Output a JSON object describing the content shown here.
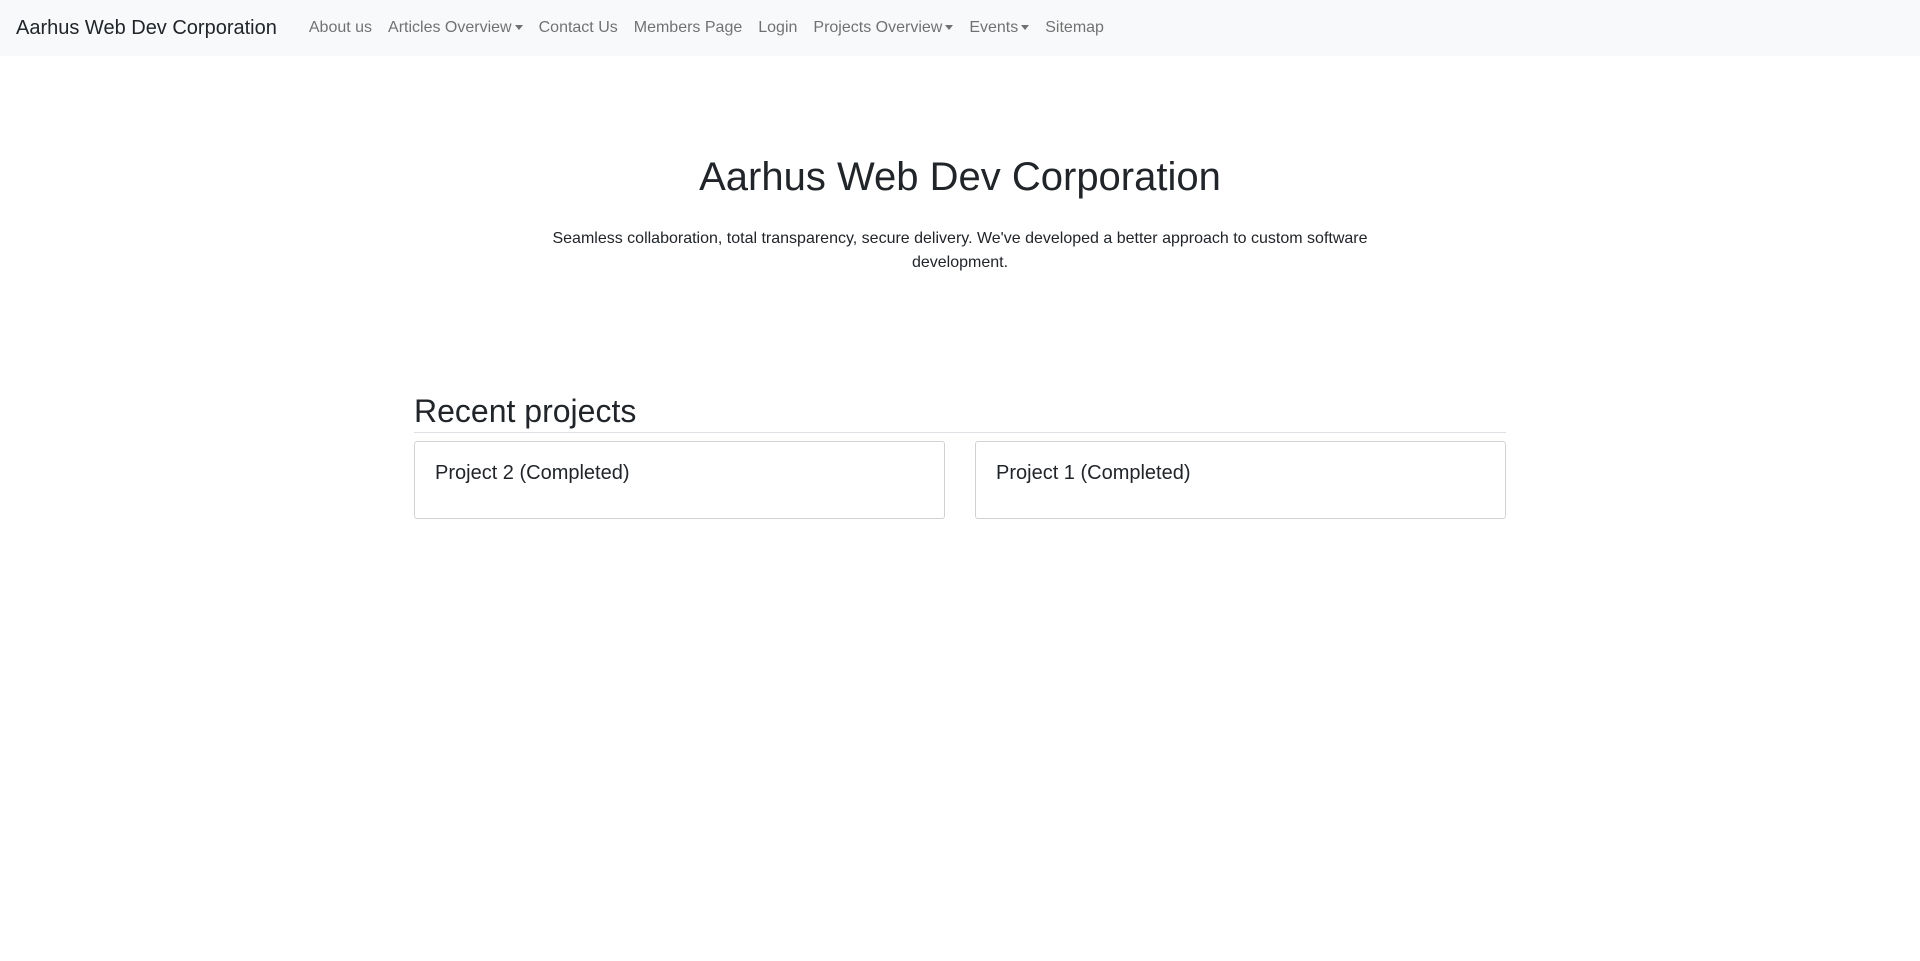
{
  "navbar": {
    "brand": "Aarhus Web Dev Corporation",
    "items": [
      {
        "label": "About us",
        "dropdown": false
      },
      {
        "label": "Articles Overview",
        "dropdown": true
      },
      {
        "label": "Contact Us",
        "dropdown": false
      },
      {
        "label": "Members Page",
        "dropdown": false
      },
      {
        "label": "Login",
        "dropdown": false
      },
      {
        "label": "Projects Overview",
        "dropdown": true
      },
      {
        "label": "Events",
        "dropdown": true
      },
      {
        "label": "Sitemap",
        "dropdown": false
      }
    ]
  },
  "hero": {
    "title": "Aarhus Web Dev Corporation",
    "lead": "Seamless collaboration, total transparency, secure delivery. We've developed a better approach to custom software development."
  },
  "recent_projects": {
    "heading": "Recent projects",
    "cards": [
      {
        "title": "Project 2 (Completed)"
      },
      {
        "title": "Project 1 (Completed)"
      }
    ]
  },
  "colors": {
    "navbar_bg": "#f8f9fa",
    "text": "#212529",
    "nav_link": "rgba(0,0,0,0.55)"
  }
}
